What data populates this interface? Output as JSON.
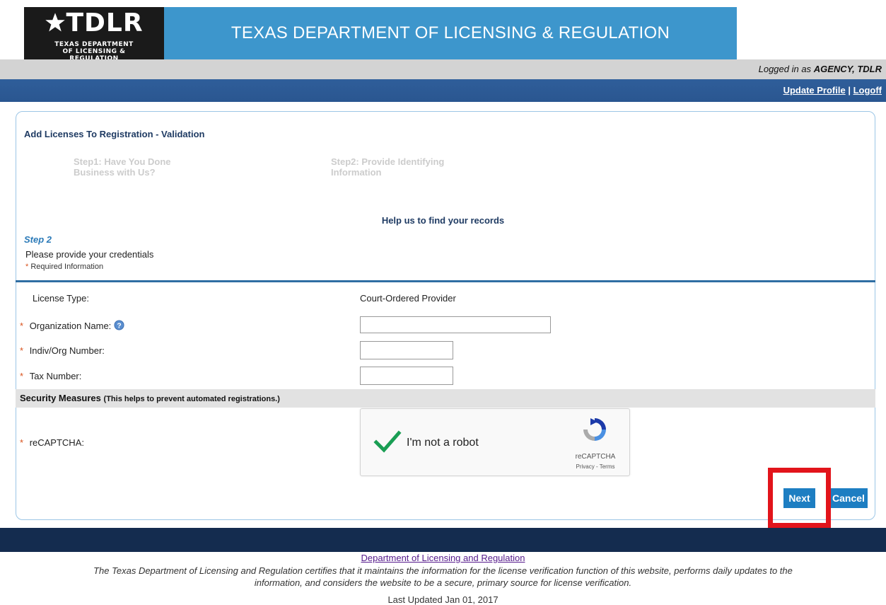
{
  "header": {
    "logo_text": "TDLR",
    "logo_subtext": "TEXAS DEPARTMENT OF LICENSING & REGULATION",
    "title": "TEXAS DEPARTMENT OF LICENSING & REGULATION",
    "logged_in_prefix": "Logged in as",
    "logged_in_user": "AGENCY, TDLR",
    "update_profile": "Update Profile",
    "separator": "|",
    "logoff": "Logoff"
  },
  "panel": {
    "title": "Add Licenses To Registration - Validation",
    "step1": "Step1: Have You Done Business with Us?",
    "step2_nav": "Step2: Provide Identifying Information",
    "help": "Help us to find your records",
    "step_label": "Step 2",
    "instructions": "Please provide your credentials",
    "required_star": "*",
    "required_note": "Required Information"
  },
  "form": {
    "license_type_label": "License Type:",
    "license_type_value": "Court-Ordered Provider",
    "org_name_label": "Organization Name:",
    "org_name_value": "",
    "indiv_label": "Indiv/Org Number:",
    "indiv_value": "",
    "tax_label": "Tax Number:",
    "tax_value": ""
  },
  "security": {
    "title": "Security Measures",
    "subtitle": "(This helps to prevent automated registrations.)",
    "recaptcha_label": "reCAPTCHA:",
    "checkbox_text": "I'm not a robot",
    "brand": "reCAPTCHA",
    "privacy": "Privacy",
    "dash": "-",
    "terms": "Terms"
  },
  "buttons": {
    "next": "Next",
    "cancel": "Cancel"
  },
  "footer": {
    "link": "Department of Licensing and Regulation",
    "statement": "The Texas Department of Licensing and Regulation certifies that it maintains the information for the license verification function of this website, performs daily updates to the information, and considers the website to be a secure, primary source for license verification.",
    "updated": "Last Updated Jan 01, 2017"
  },
  "colors": {
    "title_bar": "#3d96cc",
    "nav_bar": "#2f5e9a",
    "button": "#1d7ec2",
    "highlight": "#e2141b",
    "required": "#d9531e"
  },
  "icons": [
    "star-icon",
    "help-icon",
    "recaptcha-checkmark-icon",
    "recaptcha-logo-icon"
  ]
}
